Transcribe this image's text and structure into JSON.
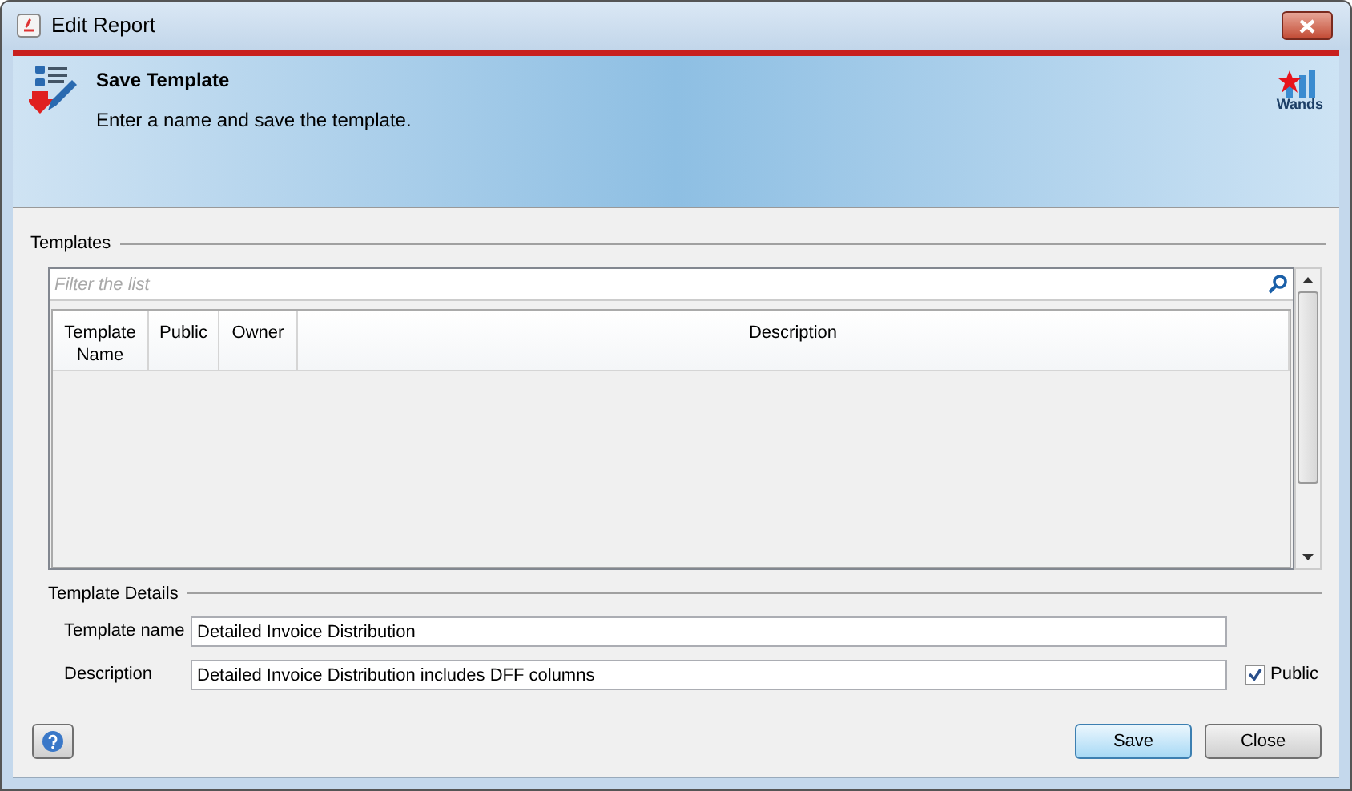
{
  "window": {
    "title": "Edit Report"
  },
  "header": {
    "title": "Save Template",
    "subtitle": "Enter a name and save the template.",
    "logo_text": "Wands"
  },
  "templates": {
    "label": "Templates",
    "filter": {
      "placeholder": "Filter the list"
    },
    "columns": [
      "Template Name",
      "Public",
      "Owner",
      "Description"
    ]
  },
  "details": {
    "label": "Template Details",
    "name": {
      "label": "Template name",
      "value": "Detailed Invoice Distribution"
    },
    "description": {
      "label": "Description",
      "value": "Detailed Invoice Distribution includes DFF columns"
    },
    "public": {
      "label": "Public",
      "checked": true
    }
  },
  "buttons": [
    {
      "label": "Save",
      "kind": "default"
    },
    {
      "label": "Close",
      "kind": "normal"
    }
  ]
}
